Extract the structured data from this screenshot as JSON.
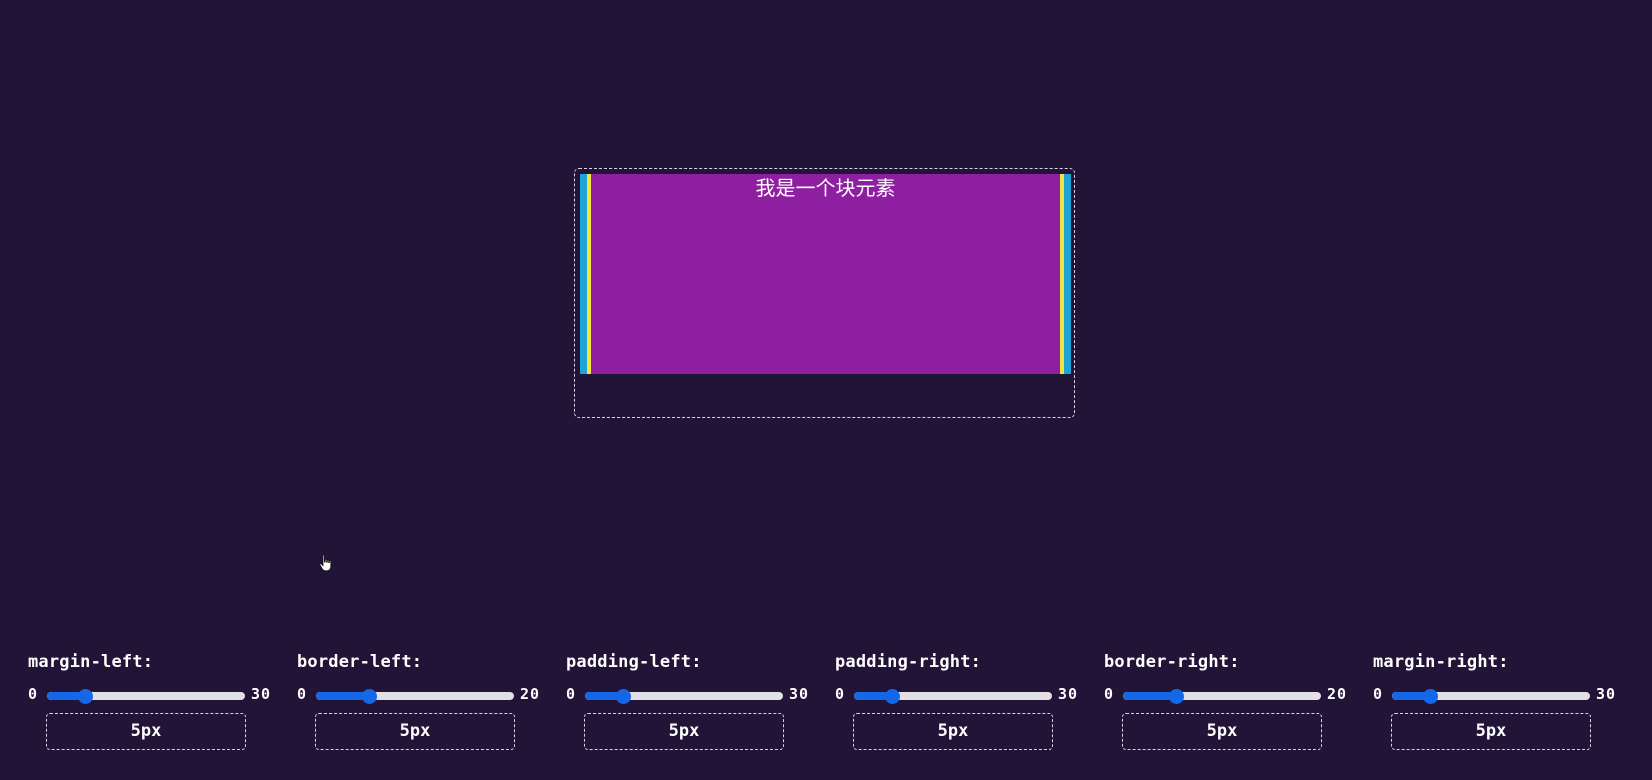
{
  "demo": {
    "block_text": "我是一个块元素"
  },
  "colors": {
    "background": "#211437",
    "content": "#8e1fa1",
    "border_yellow": "#f2e441",
    "border_blue": "#1fa3d6",
    "slider_accent": "#1468e8"
  },
  "controls": [
    {
      "label": "margin-left:",
      "min": "0",
      "max": "30",
      "value": 5,
      "display": "5px"
    },
    {
      "label": "border-left:",
      "min": "0",
      "max": "20",
      "value": 5,
      "display": "5px"
    },
    {
      "label": "padding-left:",
      "min": "0",
      "max": "30",
      "value": 5,
      "display": "5px"
    },
    {
      "label": "padding-right:",
      "min": "0",
      "max": "30",
      "value": 5,
      "display": "5px"
    },
    {
      "label": "border-right:",
      "min": "0",
      "max": "20",
      "value": 5,
      "display": "5px"
    },
    {
      "label": "margin-right:",
      "min": "0",
      "max": "30",
      "value": 5,
      "display": "5px"
    }
  ]
}
